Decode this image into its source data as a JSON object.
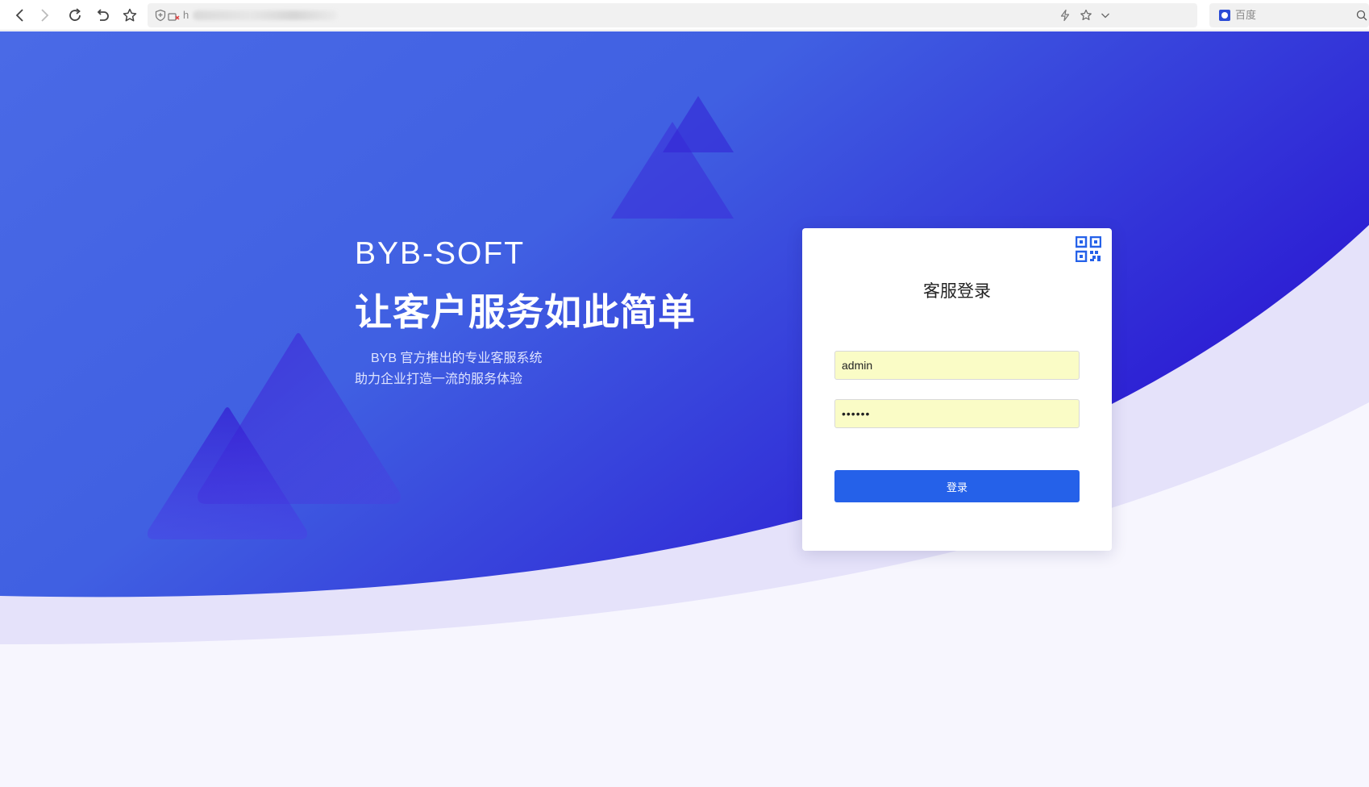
{
  "browser": {
    "url_visible_prefix": "h",
    "search_placeholder": "百度"
  },
  "hero": {
    "brand": "BYB-SOFT",
    "slogan": "让客户服务如此简单",
    "desc_line1": "BYB 官方推出的专业客服系统",
    "desc_line2": "助力企业打造一流的服务体验"
  },
  "login": {
    "title": "客服登录",
    "username_value": "admin",
    "password_value": "••••••",
    "submit_label": "登录"
  },
  "colors": {
    "hero_start": "#4a6ae6",
    "hero_end": "#2a16d2",
    "button": "#2561e9",
    "input_fill": "#fafcc6",
    "qr_icon": "#2561e9"
  },
  "icons": [
    "back-icon",
    "forward-icon",
    "reload-icon",
    "undo-icon",
    "bookmark-star-icon",
    "shield-icon",
    "insecure-icon",
    "lightning-icon",
    "star-icon",
    "chevron-down-icon",
    "baidu-logo-icon",
    "search-icon",
    "qr-code-icon"
  ]
}
